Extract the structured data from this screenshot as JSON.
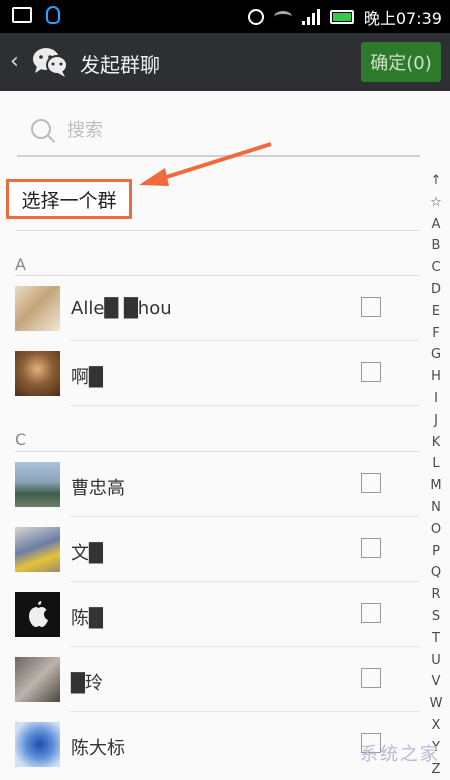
{
  "status_bar": {
    "time": "晚上07:39"
  },
  "header": {
    "title": "发起群聊",
    "confirm_label": "确定(0)"
  },
  "search": {
    "placeholder": "搜索"
  },
  "select_group_label": "选择一个群",
  "index_letters": [
    "↑",
    "☆",
    "A",
    "B",
    "C",
    "D",
    "E",
    "F",
    "G",
    "H",
    "I",
    "J",
    "K",
    "L",
    "M",
    "N",
    "O",
    "P",
    "Q",
    "R",
    "S",
    "T",
    "U",
    "V",
    "W",
    "X",
    "Y",
    "Z"
  ],
  "sections": [
    {
      "letter": "A",
      "contacts": [
        {
          "name": "Alle█ █hou"
        },
        {
          "name": "啊█"
        }
      ]
    },
    {
      "letter": "C",
      "contacts": [
        {
          "name": "曹忠高"
        },
        {
          "name": "文█"
        },
        {
          "name": "陈█"
        },
        {
          "name": "█玲"
        },
        {
          "name": "陈大标"
        }
      ]
    }
  ],
  "watermark": "系统之家",
  "colors": {
    "highlight": "#f06a3b",
    "confirm_bg": "#2e7a2d",
    "appbar_bg": "#2d2f33"
  }
}
